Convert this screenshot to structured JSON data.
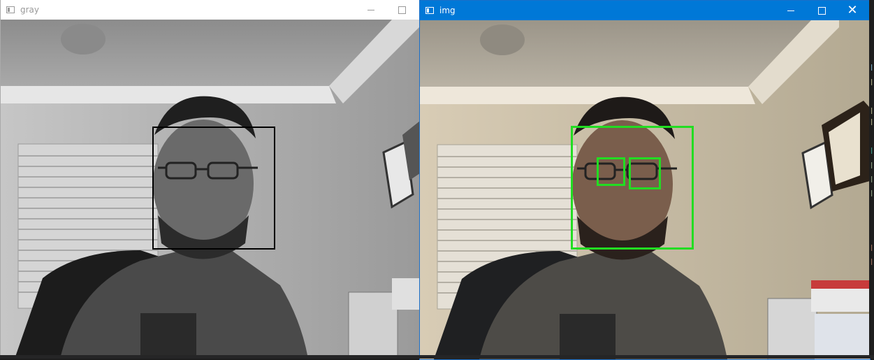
{
  "windows": {
    "gray": {
      "title": "gray",
      "controls": [
        "minimize",
        "maximize"
      ]
    },
    "img": {
      "title": "img",
      "controls": [
        "minimize",
        "maximize",
        "close"
      ]
    }
  },
  "colors": {
    "titlebar_active": "#0078d7",
    "titlebar_inactive": "#ffffff",
    "detection_face_gray": "#000000",
    "detection_face_color": "#22dd22",
    "detection_eyes": "#22dd22"
  },
  "icons": {
    "close": "✕"
  }
}
